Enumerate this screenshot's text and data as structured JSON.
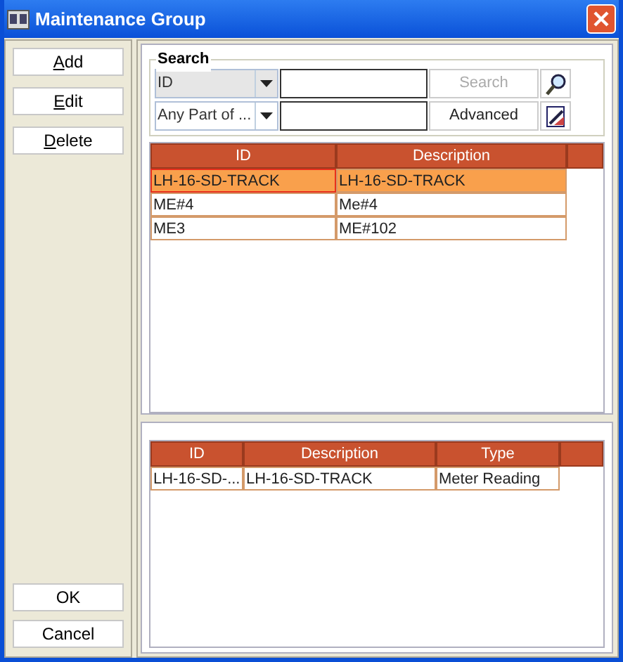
{
  "window": {
    "title": "Maintenance Group"
  },
  "side_buttons": [
    {
      "label": "Add",
      "mnemonic": true
    },
    {
      "label": "Edit",
      "mnemonic": true
    },
    {
      "label": "Delete",
      "mnemonic": true
    }
  ],
  "search": {
    "title": "Search",
    "field_select": "ID",
    "match_select": "Any Part of ...",
    "search_button": {
      "label": "Search",
      "disabled": true
    },
    "advanced_button": {
      "label": "Advanced",
      "disabled": false
    }
  },
  "groups_table": {
    "columns": [
      "ID",
      "Description"
    ],
    "rows": [
      {
        "cells": [
          "LH-16-SD-TRACK",
          "LH-16-SD-TRACK"
        ],
        "selected": true
      },
      {
        "cells": [
          "ME#4",
          "Me#4"
        ],
        "selected": false
      },
      {
        "cells": [
          "ME3",
          "ME#102"
        ],
        "selected": false
      }
    ]
  },
  "members_table": {
    "columns": [
      "ID",
      "Description",
      "Type"
    ],
    "rows": [
      {
        "cells": [
          "LH-16-SD-...",
          "LH-16-SD-TRACK",
          "Meter Reading"
        ],
        "selected": false
      }
    ]
  },
  "bottom_buttons": [
    {
      "label": "OK",
      "mnemonic": false
    },
    {
      "label": "Cancel",
      "mnemonic": false
    }
  ]
}
